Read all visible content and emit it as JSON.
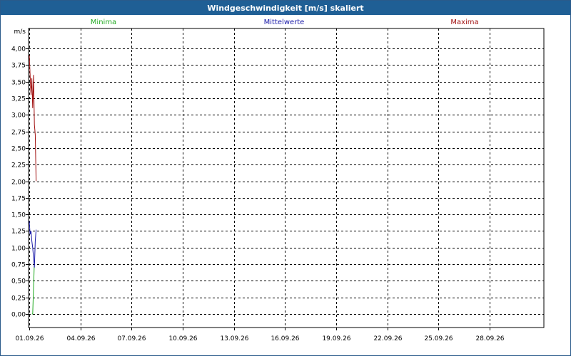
{
  "window": {
    "title": "Windgeschwindigkeit [m/s] skaliert"
  },
  "legend": {
    "min_label": "Minima",
    "mean_label": "Mittelwerte",
    "max_label": "Maxima"
  },
  "colors": {
    "min": "#22aa22",
    "mean": "#1a1aa8",
    "max": "#a01010",
    "title_bg": "#1f5f95"
  },
  "chart_data": {
    "type": "line",
    "title": "Windgeschwindigkeit [m/s] skaliert",
    "ylabel": "m/s",
    "xlabel": "",
    "ylim": [
      0,
      4.0
    ],
    "yticks": [
      "0,00",
      "0,25",
      "0,50",
      "0,75",
      "1,00",
      "1,25",
      "1,50",
      "1,75",
      "2,00",
      "2,25",
      "2,50",
      "2,75",
      "3,00",
      "3,25",
      "3,50",
      "3,75",
      "4,00"
    ],
    "xticks": [
      "01.09.26",
      "04.09.26",
      "07.09.26",
      "10.09.26",
      "13.09.26",
      "16.09.26",
      "19.09.26",
      "22.09.26",
      "25.09.26",
      "28.09.26"
    ],
    "xlim": [
      0,
      30
    ],
    "grid": true,
    "legend_position": "top",
    "series": [
      {
        "name": "Minima",
        "color": "#22aa22",
        "x": [
          0.15,
          0.2,
          0.25,
          0.3
        ],
        "y": [
          0.0,
          0.0,
          0.4,
          0.8
        ]
      },
      {
        "name": "Mittelwerte",
        "color": "#1a1aa8",
        "x": [
          0.0,
          0.05,
          0.1,
          0.15,
          0.2,
          0.25,
          0.3,
          0.35,
          0.4
        ],
        "y": [
          1.4,
          1.2,
          1.25,
          1.1,
          1.0,
          0.85,
          0.7,
          1.1,
          1.27
        ]
      },
      {
        "name": "Maxima",
        "color": "#a01010",
        "x": [
          0.0,
          0.05,
          0.1,
          0.15,
          0.2,
          0.25,
          0.3,
          0.35,
          0.4
        ],
        "y": [
          3.9,
          3.6,
          3.3,
          3.55,
          3.1,
          3.6,
          2.85,
          2.7,
          2.0
        ]
      }
    ]
  }
}
